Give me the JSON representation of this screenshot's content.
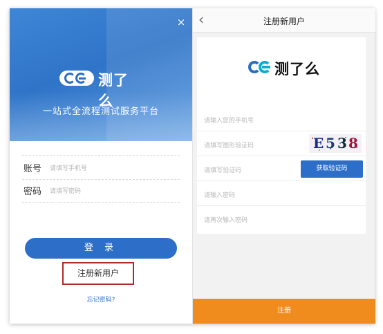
{
  "login": {
    "close_icon": "×",
    "logo_text": "测了么",
    "slogan": "一站式全流程测试服务平台",
    "account_label": "账号",
    "account_placeholder": "请填写手机号",
    "password_label": "密码",
    "password_placeholder": "请填写密码",
    "login_button": "登 录",
    "register_link": "注册新用户",
    "forgot_link": "忘记密码?"
  },
  "register": {
    "back_icon": "‹",
    "title": "注册新用户",
    "logo_text": "测了么",
    "phone_placeholder": "请输入您的手机号",
    "captcha_placeholder": "请填写图形验证码",
    "captcha_chars": [
      "E",
      "5",
      "3",
      "8"
    ],
    "sms_placeholder": "请填写验证码",
    "get_code_button": "获取验证码",
    "password_placeholder": "请输入密码",
    "confirm_placeholder": "请再次输入密码",
    "submit_button": "注册"
  },
  "colors": {
    "brand_blue": "#2d6fc8",
    "highlight_red": "#b02a2a",
    "submit_orange": "#f08b1e"
  },
  "icons": {
    "close": "close-icon",
    "back": "back-arrow-icon",
    "logo": "cheliaome-logo-icon"
  }
}
